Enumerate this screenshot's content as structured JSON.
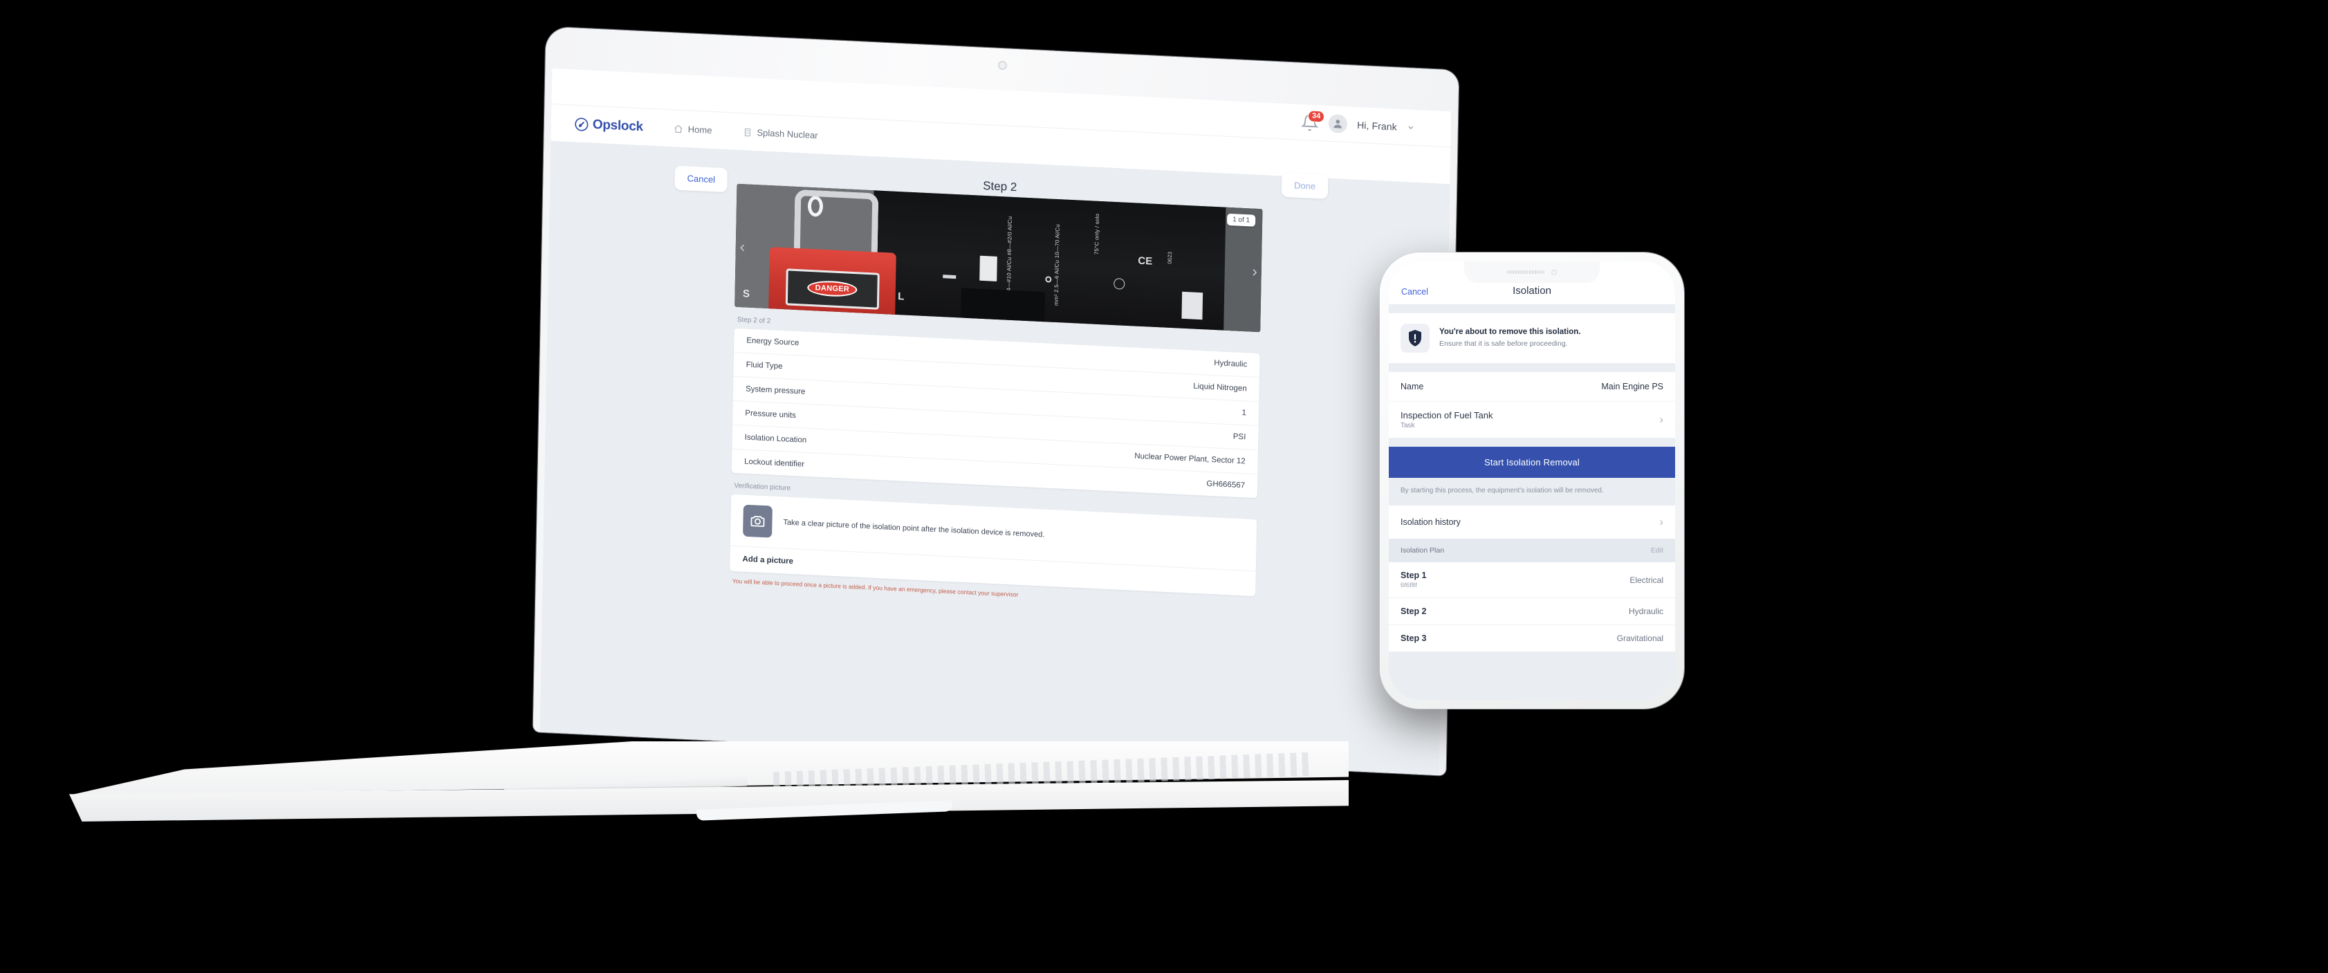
{
  "desktop": {
    "userbar": {
      "notification_count": "34",
      "greeting": "Hi, Frank",
      "bell_icon": "bell-icon",
      "avatar_icon": "avatar-icon",
      "chevron_icon": "chevron-down-icon"
    },
    "nav": {
      "logo_text": "Opslock",
      "logo_icon": "opslock-logo-icon",
      "breadcrumbs": [
        {
          "label": "Home",
          "icon": "home-icon"
        },
        {
          "label": "Splash Nuclear",
          "icon": "building-icon"
        }
      ]
    },
    "page": {
      "title": "Step 2",
      "cancel_label": "Cancel",
      "done_label": "Done"
    },
    "carousel": {
      "counter": "1 of 1",
      "prev_icon": "chevron-left-icon",
      "next_icon": "chevron-right-icon",
      "photo_alt": "Red safety padlock with DANGER tag on black electrical panel",
      "photo_labels": {
        "danger": "DANGER",
        "s_letter": "S",
        "l_letter": "L",
        "awg": "AWG\n#14—#10  Al/Cu\n#8—#2/0  Al/Cu",
        "mm": "mm²\n2.5—6  Al/Cu\n10—70  Al/Cu",
        "temp": "75°C only / solo",
        "ce": "CE",
        "code": "0623"
      }
    },
    "details": {
      "section_label": "Step 2 of 2",
      "rows": [
        {
          "key": "Energy Source",
          "value": "Hydraulic"
        },
        {
          "key": "Fluid Type",
          "value": "Liquid Nitrogen"
        },
        {
          "key": "System pressure",
          "value": "1"
        },
        {
          "key": "Pressure units",
          "value": "PSI"
        },
        {
          "key": "Isolation Location",
          "value": "Nuclear Power Plant, Sector 12"
        },
        {
          "key": "Lockout identifier",
          "value": "GH666567"
        }
      ]
    },
    "verification": {
      "section_label": "Verification picture",
      "camera_icon": "camera-icon",
      "instruction": "Take a clear picture of the isolation point after the isolation device is removed.",
      "add_label": "Add a picture",
      "footnote": "You will be able to proceed once a picture is added. If you have an emergency, please contact your supervisor"
    }
  },
  "phone": {
    "nav": {
      "cancel_label": "Cancel",
      "title": "Isolation"
    },
    "alert": {
      "icon": "shield-warning-icon",
      "heading": "You're about to remove this isolation.",
      "subtext": "Ensure that it is safe before proceeding."
    },
    "info": {
      "name_key": "Name",
      "name_value": "Main Engine PS",
      "task_title": "Inspection of Fuel Tank",
      "task_subtitle": "Task",
      "chevron_icon": "chevron-right-icon"
    },
    "cta": {
      "label": "Start Isolation Removal",
      "note": "By starting this process, the equipment's isolation will be removed."
    },
    "history": {
      "label": "Isolation history",
      "chevron_icon": "chevron-right-icon"
    },
    "plan": {
      "header": "Isolation Plan",
      "edit_label": "Edit",
      "steps": [
        {
          "name": "Step 1",
          "id": "6f6f8f",
          "type": "Electrical"
        },
        {
          "name": "Step 2",
          "id": "",
          "type": "Hydraulic"
        },
        {
          "name": "Step 3",
          "id": "",
          "type": "Gravitational"
        }
      ]
    }
  },
  "colors": {
    "brand_blue": "#3551ad",
    "link_blue": "#4262d8",
    "page_bg": "#eaedf1",
    "danger_red": "#d93b31",
    "badge_red": "#e8453c",
    "navy": "#1f2a44"
  }
}
